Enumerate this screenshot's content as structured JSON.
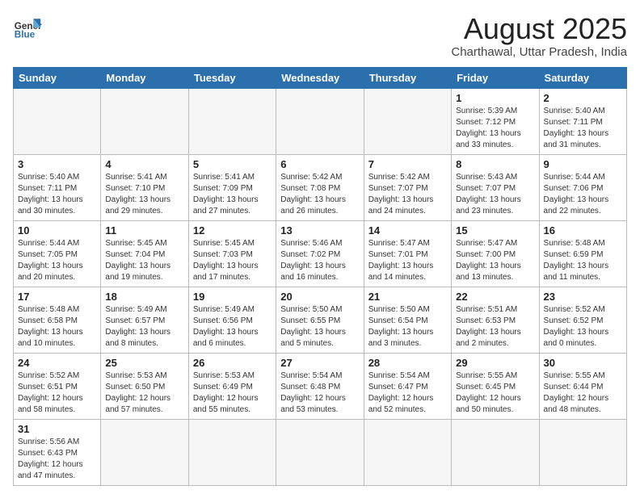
{
  "logo": {
    "text_general": "General",
    "text_blue": "Blue"
  },
  "title": "August 2025",
  "subtitle": "Charthawal, Uttar Pradesh, India",
  "weekdays": [
    "Sunday",
    "Monday",
    "Tuesday",
    "Wednesday",
    "Thursday",
    "Friday",
    "Saturday"
  ],
  "weeks": [
    [
      {
        "day": "",
        "info": "",
        "empty": true
      },
      {
        "day": "",
        "info": "",
        "empty": true
      },
      {
        "day": "",
        "info": "",
        "empty": true
      },
      {
        "day": "",
        "info": "",
        "empty": true
      },
      {
        "day": "",
        "info": "",
        "empty": true
      },
      {
        "day": "1",
        "info": "Sunrise: 5:39 AM\nSunset: 7:12 PM\nDaylight: 13 hours\nand 33 minutes."
      },
      {
        "day": "2",
        "info": "Sunrise: 5:40 AM\nSunset: 7:11 PM\nDaylight: 13 hours\nand 31 minutes."
      }
    ],
    [
      {
        "day": "3",
        "info": "Sunrise: 5:40 AM\nSunset: 7:11 PM\nDaylight: 13 hours\nand 30 minutes."
      },
      {
        "day": "4",
        "info": "Sunrise: 5:41 AM\nSunset: 7:10 PM\nDaylight: 13 hours\nand 29 minutes."
      },
      {
        "day": "5",
        "info": "Sunrise: 5:41 AM\nSunset: 7:09 PM\nDaylight: 13 hours\nand 27 minutes."
      },
      {
        "day": "6",
        "info": "Sunrise: 5:42 AM\nSunset: 7:08 PM\nDaylight: 13 hours\nand 26 minutes."
      },
      {
        "day": "7",
        "info": "Sunrise: 5:42 AM\nSunset: 7:07 PM\nDaylight: 13 hours\nand 24 minutes."
      },
      {
        "day": "8",
        "info": "Sunrise: 5:43 AM\nSunset: 7:07 PM\nDaylight: 13 hours\nand 23 minutes."
      },
      {
        "day": "9",
        "info": "Sunrise: 5:44 AM\nSunset: 7:06 PM\nDaylight: 13 hours\nand 22 minutes."
      }
    ],
    [
      {
        "day": "10",
        "info": "Sunrise: 5:44 AM\nSunset: 7:05 PM\nDaylight: 13 hours\nand 20 minutes."
      },
      {
        "day": "11",
        "info": "Sunrise: 5:45 AM\nSunset: 7:04 PM\nDaylight: 13 hours\nand 19 minutes."
      },
      {
        "day": "12",
        "info": "Sunrise: 5:45 AM\nSunset: 7:03 PM\nDaylight: 13 hours\nand 17 minutes."
      },
      {
        "day": "13",
        "info": "Sunrise: 5:46 AM\nSunset: 7:02 PM\nDaylight: 13 hours\nand 16 minutes."
      },
      {
        "day": "14",
        "info": "Sunrise: 5:47 AM\nSunset: 7:01 PM\nDaylight: 13 hours\nand 14 minutes."
      },
      {
        "day": "15",
        "info": "Sunrise: 5:47 AM\nSunset: 7:00 PM\nDaylight: 13 hours\nand 13 minutes."
      },
      {
        "day": "16",
        "info": "Sunrise: 5:48 AM\nSunset: 6:59 PM\nDaylight: 13 hours\nand 11 minutes."
      }
    ],
    [
      {
        "day": "17",
        "info": "Sunrise: 5:48 AM\nSunset: 6:58 PM\nDaylight: 13 hours\nand 10 minutes."
      },
      {
        "day": "18",
        "info": "Sunrise: 5:49 AM\nSunset: 6:57 PM\nDaylight: 13 hours\nand 8 minutes."
      },
      {
        "day": "19",
        "info": "Sunrise: 5:49 AM\nSunset: 6:56 PM\nDaylight: 13 hours\nand 6 minutes."
      },
      {
        "day": "20",
        "info": "Sunrise: 5:50 AM\nSunset: 6:55 PM\nDaylight: 13 hours\nand 5 minutes."
      },
      {
        "day": "21",
        "info": "Sunrise: 5:50 AM\nSunset: 6:54 PM\nDaylight: 13 hours\nand 3 minutes."
      },
      {
        "day": "22",
        "info": "Sunrise: 5:51 AM\nSunset: 6:53 PM\nDaylight: 13 hours\nand 2 minutes."
      },
      {
        "day": "23",
        "info": "Sunrise: 5:52 AM\nSunset: 6:52 PM\nDaylight: 13 hours\nand 0 minutes."
      }
    ],
    [
      {
        "day": "24",
        "info": "Sunrise: 5:52 AM\nSunset: 6:51 PM\nDaylight: 12 hours\nand 58 minutes."
      },
      {
        "day": "25",
        "info": "Sunrise: 5:53 AM\nSunset: 6:50 PM\nDaylight: 12 hours\nand 57 minutes."
      },
      {
        "day": "26",
        "info": "Sunrise: 5:53 AM\nSunset: 6:49 PM\nDaylight: 12 hours\nand 55 minutes."
      },
      {
        "day": "27",
        "info": "Sunrise: 5:54 AM\nSunset: 6:48 PM\nDaylight: 12 hours\nand 53 minutes."
      },
      {
        "day": "28",
        "info": "Sunrise: 5:54 AM\nSunset: 6:47 PM\nDaylight: 12 hours\nand 52 minutes."
      },
      {
        "day": "29",
        "info": "Sunrise: 5:55 AM\nSunset: 6:45 PM\nDaylight: 12 hours\nand 50 minutes."
      },
      {
        "day": "30",
        "info": "Sunrise: 5:55 AM\nSunset: 6:44 PM\nDaylight: 12 hours\nand 48 minutes."
      }
    ],
    [
      {
        "day": "31",
        "info": "Sunrise: 5:56 AM\nSunset: 6:43 PM\nDaylight: 12 hours\nand 47 minutes."
      },
      {
        "day": "",
        "info": "",
        "empty": true
      },
      {
        "day": "",
        "info": "",
        "empty": true
      },
      {
        "day": "",
        "info": "",
        "empty": true
      },
      {
        "day": "",
        "info": "",
        "empty": true
      },
      {
        "day": "",
        "info": "",
        "empty": true
      },
      {
        "day": "",
        "info": "",
        "empty": true
      }
    ]
  ]
}
